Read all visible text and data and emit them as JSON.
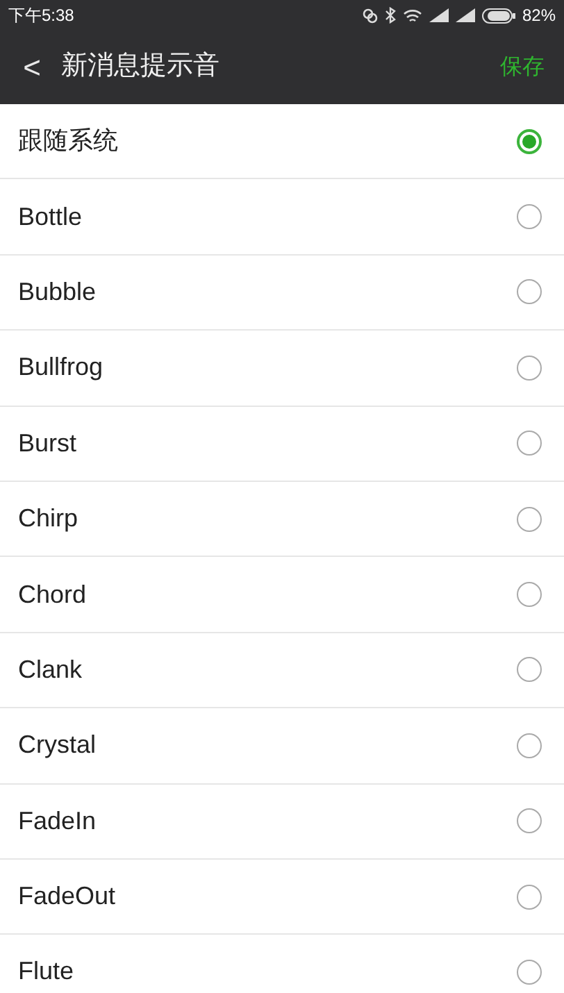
{
  "status_bar": {
    "time": "下午5:38",
    "battery": "82%"
  },
  "header": {
    "back": "<",
    "title": "新消息提示音",
    "save": "保存"
  },
  "options": [
    {
      "label": "跟随系统",
      "selected": true
    },
    {
      "label": "Bottle",
      "selected": false
    },
    {
      "label": "Bubble",
      "selected": false
    },
    {
      "label": "Bullfrog",
      "selected": false
    },
    {
      "label": "Burst",
      "selected": false
    },
    {
      "label": "Chirp",
      "selected": false
    },
    {
      "label": "Chord",
      "selected": false
    },
    {
      "label": "Clank",
      "selected": false
    },
    {
      "label": "Crystal",
      "selected": false
    },
    {
      "label": "FadeIn",
      "selected": false
    },
    {
      "label": "FadeOut",
      "selected": false
    },
    {
      "label": "Flute",
      "selected": false
    }
  ]
}
